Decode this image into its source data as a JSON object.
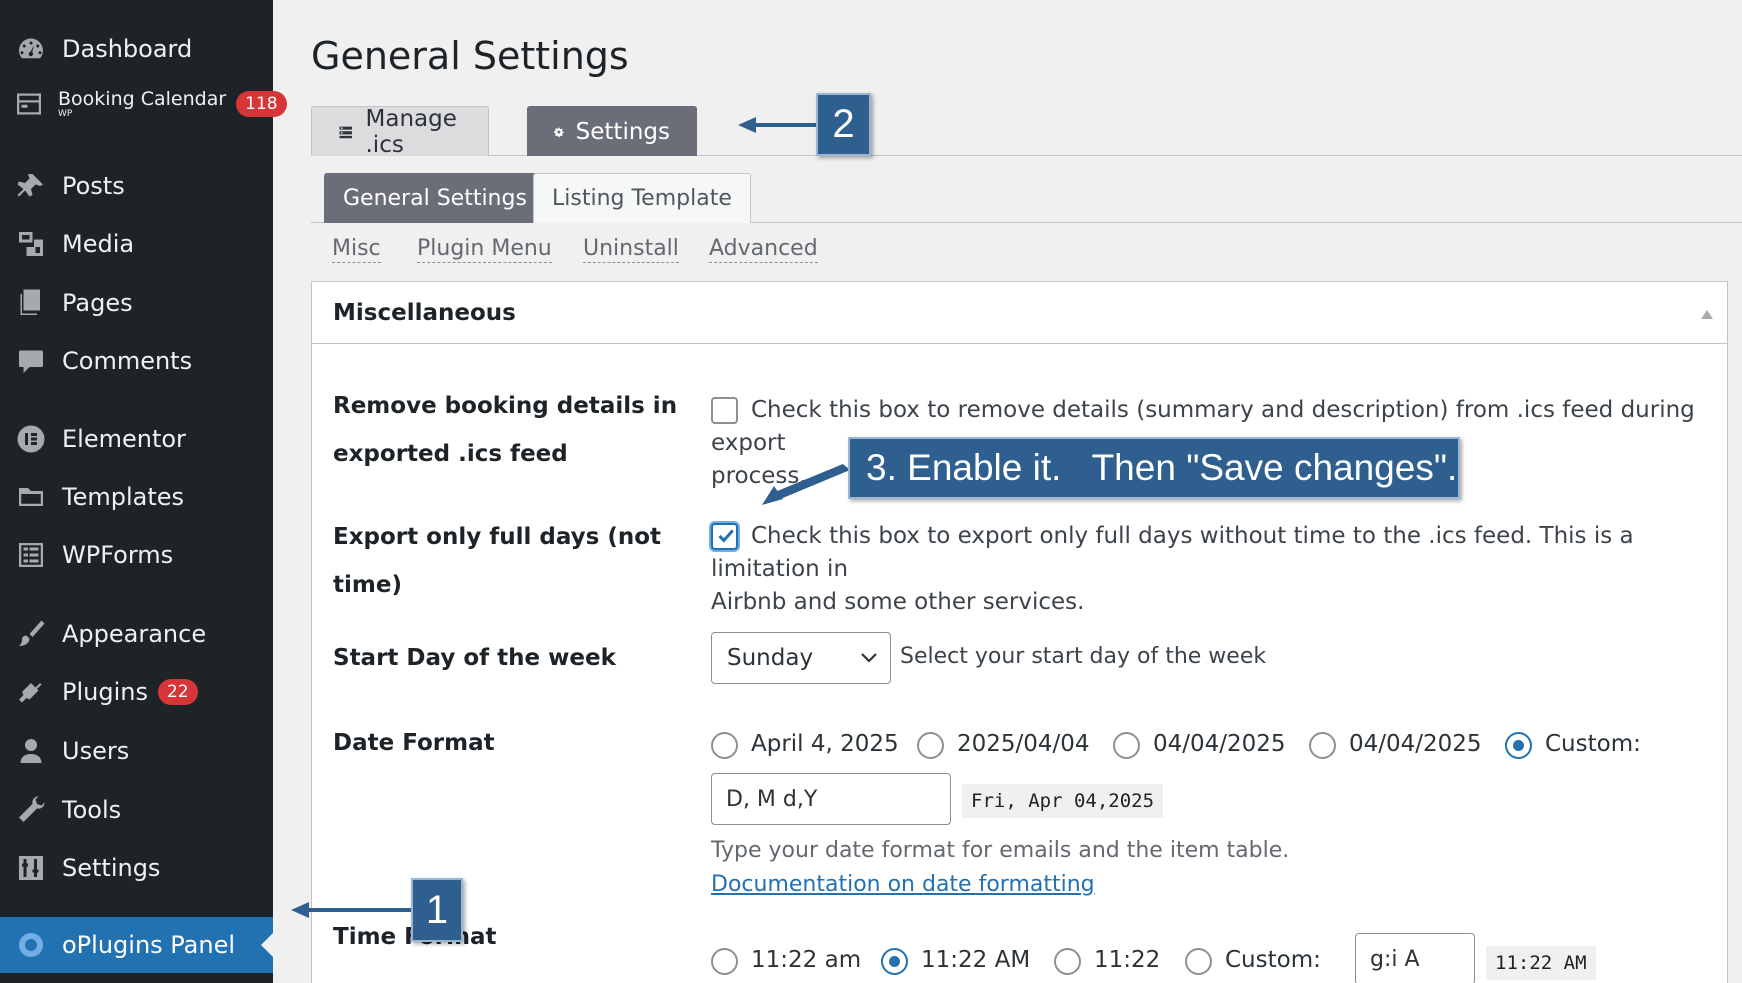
{
  "sidebar": {
    "items": [
      {
        "label": "Dashboard",
        "icon": "dashboard-icon"
      },
      {
        "label": "Booking Calendar",
        "sub": "WP",
        "badge": "118",
        "icon": "calendar-icon"
      },
      {
        "label": "Posts",
        "icon": "pin-icon"
      },
      {
        "label": "Media",
        "icon": "media-icon"
      },
      {
        "label": "Pages",
        "icon": "pages-icon"
      },
      {
        "label": "Comments",
        "icon": "comment-icon"
      },
      {
        "label": "Elementor",
        "icon": "elementor-icon"
      },
      {
        "label": "Templates",
        "icon": "folder-icon"
      },
      {
        "label": "WPForms",
        "icon": "forms-icon"
      },
      {
        "label": "Appearance",
        "icon": "brush-icon"
      },
      {
        "label": "Plugins",
        "badge": "22",
        "icon": "plugin-icon"
      },
      {
        "label": "Users",
        "icon": "user-icon"
      },
      {
        "label": "Tools",
        "icon": "wrench-icon"
      },
      {
        "label": "Settings",
        "icon": "sliders-icon"
      },
      {
        "label": "oPlugins Panel",
        "icon": "oplugins-icon",
        "active": true
      }
    ]
  },
  "page": {
    "title": "General Settings"
  },
  "tabs": [
    {
      "label": "Manage .ics",
      "icon": "list-icon"
    },
    {
      "label": "Settings",
      "icon": "gear-icon",
      "active": true
    }
  ],
  "subtabs": [
    {
      "label": "General Settings",
      "active": true
    },
    {
      "label": "Listing Template"
    }
  ],
  "anchors": [
    "Misc",
    "Plugin Menu",
    "Uninstall",
    "Advanced"
  ],
  "panel": {
    "title": "Miscellaneous",
    "remove_details": {
      "label_line1": "Remove booking details in",
      "label_line2": "exported .ics feed",
      "desc_line1": "Check this box to remove details (summary and description) from .ics feed during export",
      "desc_line2": "process.",
      "checked": false
    },
    "full_days": {
      "label": "Export only full days (not time)",
      "desc_line1": "Check this box to export only full days without time to the .ics feed. This is a limitation in",
      "desc_line2": "Airbnb and some other services.",
      "checked": true
    },
    "start_day": {
      "label": "Start Day of the week",
      "value": "Sunday",
      "help": "Select your start day of the week"
    },
    "date_format": {
      "label": "Date Format",
      "options": [
        "April 4, 2025",
        "2025/04/04",
        "04/04/2025",
        "04/04/2025",
        "Custom:"
      ],
      "selected": "Custom:",
      "custom_value": "D, M d,Y",
      "preview": "Fri, Apr 04,2025",
      "help": "Type your date format for emails and the item table.",
      "doc_link": "Documentation on date formatting"
    },
    "time_format": {
      "label": "Time Format",
      "options": [
        "11:22 am",
        "11:22 AM",
        "11:22",
        "Custom:"
      ],
      "selected": "11:22 AM",
      "custom_value": "g:i A",
      "preview": "11:22 AM"
    }
  },
  "annotations": {
    "step1": "1",
    "step2": "2",
    "step3": "3. Enable it.   Then \"Save changes\"."
  },
  "colors": {
    "sidebar_bg": "#1d2327",
    "active_bg": "#2271b1",
    "callout_bg": "#2e5f8e",
    "tab_active_bg": "#6b6e78",
    "badge_bg": "#d63638"
  }
}
